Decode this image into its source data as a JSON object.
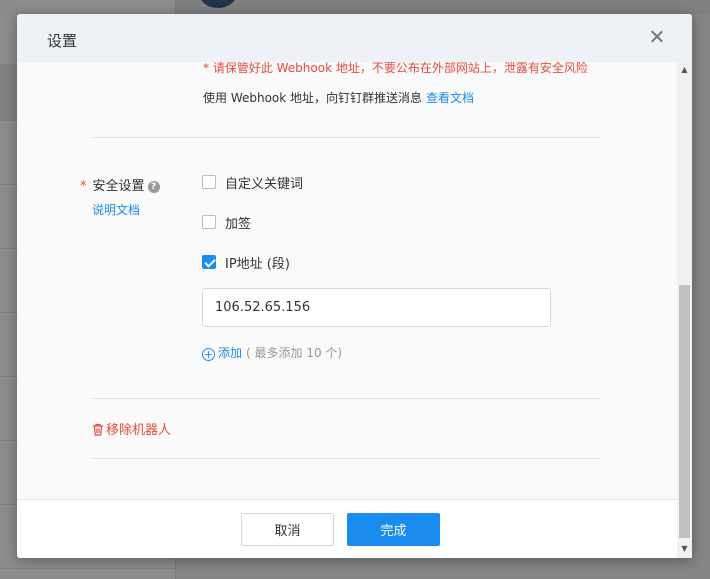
{
  "dialog": {
    "title": "设置",
    "warning": "* 请保管好此 Webhook 地址，不要公布在外部网站上，泄露有安全风险",
    "webhook_desc": "使用 Webhook 地址，向钉钉群推送消息",
    "view_docs_link": "查看文档",
    "security": {
      "required_mark": "*",
      "label": "安全设置",
      "help_icon": "question-circle-icon",
      "doc_link": "说明文档",
      "options": [
        {
          "label": "自定义关键词",
          "checked": false
        },
        {
          "label": "加签",
          "checked": false
        },
        {
          "label": "IP地址 (段)",
          "checked": true
        }
      ],
      "ip_value": "106.52.65.156",
      "add_label": "添加",
      "add_hint": "( 最多添加 10 个)"
    },
    "remove_robot": "移除机器人",
    "cancel_label": "取消",
    "confirm_label": "完成"
  },
  "colors": {
    "accent": "#1a8cf0",
    "danger": "#e84c3d"
  }
}
